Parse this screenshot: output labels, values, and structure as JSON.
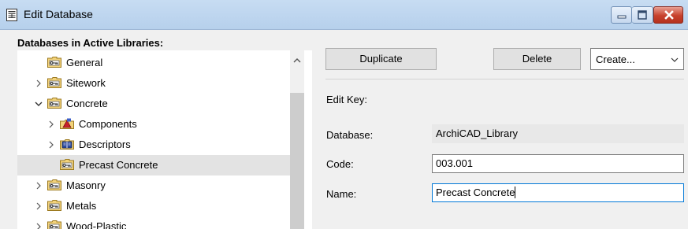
{
  "window": {
    "title": "Edit Database",
    "icons": {
      "app": "database-sheet-icon",
      "minimize": "minimize-icon",
      "maximize": "maximize-icon",
      "close": "close-icon"
    }
  },
  "tree": {
    "header": "Databases in Active Libraries:",
    "items": [
      {
        "label": "General",
        "icon": "key-folder-icon",
        "expander": "none"
      },
      {
        "label": "Sitework",
        "icon": "key-folder-icon",
        "expander": "collapsed"
      },
      {
        "label": "Concrete",
        "icon": "key-folder-icon",
        "expander": "expanded"
      },
      {
        "label": "Components",
        "icon": "components-folder-icon",
        "expander": "collapsed"
      },
      {
        "label": "Descriptors",
        "icon": "descriptors-folder-icon",
        "expander": "collapsed"
      },
      {
        "label": "Precast Concrete",
        "icon": "key-folder-icon",
        "expander": "none",
        "selected": true
      },
      {
        "label": "Masonry",
        "icon": "key-folder-icon",
        "expander": "collapsed"
      },
      {
        "label": "Metals",
        "icon": "key-folder-icon",
        "expander": "collapsed"
      },
      {
        "label": "Wood-Plastic",
        "icon": "key-folder-icon",
        "expander": "collapsed"
      }
    ]
  },
  "toolbar": {
    "duplicate_label": "Duplicate",
    "delete_label": "Delete",
    "create_value": "Create..."
  },
  "edit": {
    "section_label": "Edit Key:",
    "database_label": "Database:",
    "database_value": "ArchiCAD_Library",
    "code_label": "Code:",
    "code_value": "003.001",
    "name_label": "Name:",
    "name_value": "Precast Concrete"
  },
  "colors": {
    "titlebar": "#bcd4ee",
    "selection": "#e3e3e3",
    "focus_border": "#0078d7",
    "close_button": "#c7402c"
  }
}
